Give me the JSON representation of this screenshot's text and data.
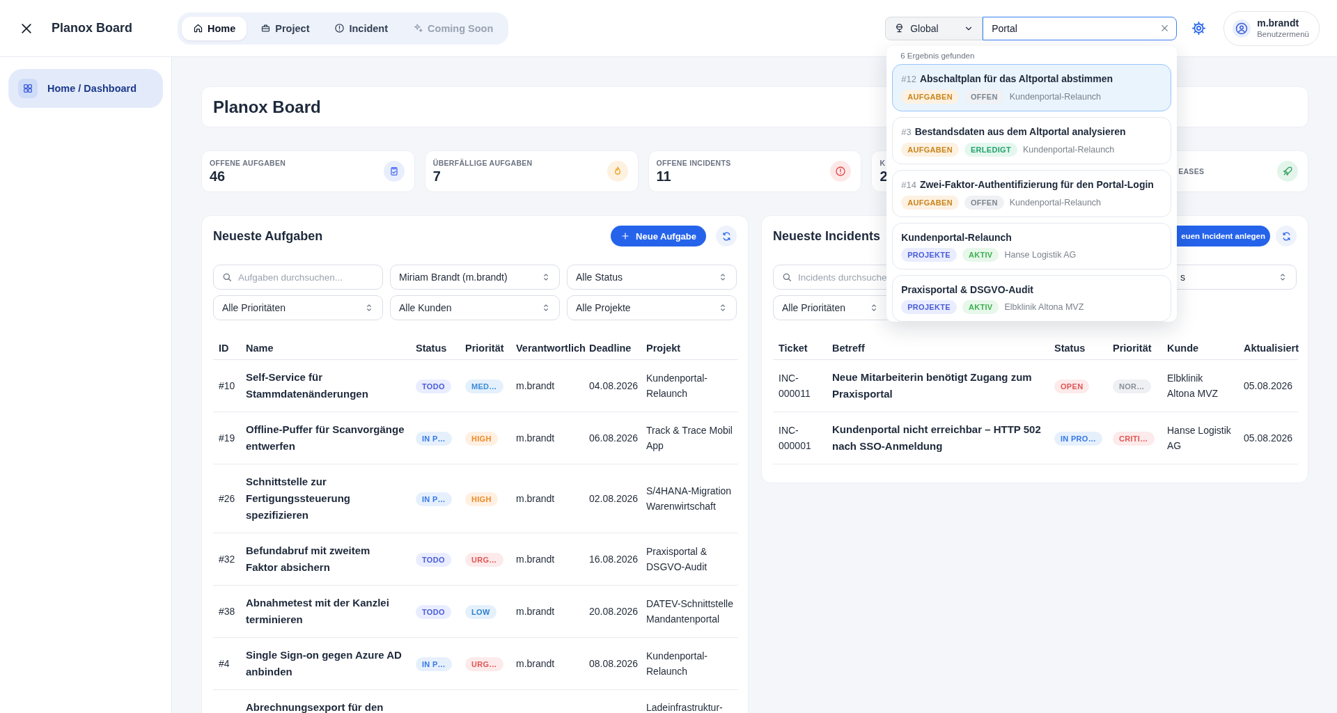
{
  "app": {
    "title": "Planox Board"
  },
  "nav": {
    "tabs": [
      {
        "label": "Home",
        "selected": true,
        "disabled": false
      },
      {
        "label": "Project",
        "selected": false,
        "disabled": false
      },
      {
        "label": "Incident",
        "selected": false,
        "disabled": false
      },
      {
        "label": "Coming Soon",
        "selected": false,
        "disabled": true
      }
    ]
  },
  "search": {
    "scope": "Global",
    "query": "Portal",
    "count": "6 Ergebnis gefunden",
    "results": [
      {
        "ref": "#12",
        "title": "Abschaltplan für das Altportal abstimmen",
        "type": {
          "label": "AUFGABEN",
          "kind": "task"
        },
        "state": {
          "label": "OFFEN",
          "kind": "open"
        },
        "context": "Kundenportal-Relaunch",
        "selected": true
      },
      {
        "ref": "#3",
        "title": "Bestandsdaten aus dem Altportal analysieren",
        "type": {
          "label": "AUFGABEN",
          "kind": "task"
        },
        "state": {
          "label": "ERLEDIGT",
          "kind": "done"
        },
        "context": "Kundenportal-Relaunch",
        "selected": false
      },
      {
        "ref": "#14",
        "title": "Zwei-Faktor-Authentifizierung für den Portal-Login",
        "type": {
          "label": "AUFGABEN",
          "kind": "task"
        },
        "state": {
          "label": "OFFEN",
          "kind": "open"
        },
        "context": "Kundenportal-Relaunch",
        "selected": false
      },
      {
        "title": "Kundenportal-Relaunch",
        "type": {
          "label": "PROJEKTE",
          "kind": "project"
        },
        "state": {
          "label": "AKTIV",
          "kind": "active"
        },
        "context": "Hanse Logistik AG",
        "selected": false
      },
      {
        "title": "Praxisportal & DSGVO-Audit",
        "type": {
          "label": "PROJEKTE",
          "kind": "project"
        },
        "state": {
          "label": "AKTIV",
          "kind": "active"
        },
        "context": "Elbklinik Altona MVZ",
        "selected": false
      }
    ]
  },
  "user": {
    "name": "m.brandt",
    "role": "Benutzermenü"
  },
  "sidebar": {
    "items": [
      {
        "label": "Home / Dashboard",
        "selected": true
      }
    ]
  },
  "page": {
    "title": "Planox Board"
  },
  "kpis": [
    {
      "label": "OFFENE AUFGABEN",
      "value": "46"
    },
    {
      "label": "ÜBERFÄLLIGE AUFGABEN",
      "value": "7"
    },
    {
      "label": "OFFENE INCIDENTS",
      "value": "11"
    },
    {
      "label": "K",
      "value": "2"
    },
    {
      "label": "EASES"
    }
  ],
  "tasks": {
    "title": "Neueste Aufgaben",
    "new_button": "Neue Aufgabe",
    "search_placeholder": "Aufgaben durchsuchen...",
    "filters": [
      "Miriam Brandt (m.brandt)",
      "Alle Status",
      "Alle Prioritäten",
      "Alle Kunden",
      "Alle Projekte"
    ],
    "columns": [
      "ID",
      "Name",
      "Status",
      "Priorität",
      "Verantwortlich",
      "Deadline",
      "Projekt"
    ],
    "rows": [
      {
        "id": "#10",
        "name": "Self-Service für Stammdatenänderungen",
        "status": {
          "label": "TODO",
          "kind": "todo"
        },
        "priority": {
          "label": "MED…",
          "kind": "medium"
        },
        "owner": "m.brandt",
        "deadline": "04.08.2026",
        "project": "Kundenportal-Relaunch"
      },
      {
        "id": "#19",
        "name": "Offline-Puffer für Scanvorgänge entwerfen",
        "status": {
          "label": "IN P…",
          "kind": "in_progress"
        },
        "priority": {
          "label": "HIGH",
          "kind": "high"
        },
        "owner": "m.brandt",
        "deadline": "06.08.2026",
        "project": "Track & Trace Mobil App"
      },
      {
        "id": "#26",
        "name": "Schnittstelle zur Fertigungssteuerung spezifizieren",
        "status": {
          "label": "IN P…",
          "kind": "in_progress"
        },
        "priority": {
          "label": "HIGH",
          "kind": "high"
        },
        "owner": "m.brandt",
        "deadline": "02.08.2026",
        "project": "S/4HANA-Migration Warenwirtschaft"
      },
      {
        "id": "#32",
        "name": "Befundabruf mit zweitem Faktor absichern",
        "status": {
          "label": "TODO",
          "kind": "todo"
        },
        "priority": {
          "label": "URG…",
          "kind": "urgent"
        },
        "owner": "m.brandt",
        "deadline": "16.08.2026",
        "project": "Praxisportal & DSGVO-Audit"
      },
      {
        "id": "#38",
        "name": "Abnahmetest mit der Kanzlei terminieren",
        "status": {
          "label": "TODO",
          "kind": "todo"
        },
        "priority": {
          "label": "LOW",
          "kind": "low"
        },
        "owner": "m.brandt",
        "deadline": "20.08.2026",
        "project": "DATEV-Schnittstelle Mandantenportal"
      },
      {
        "id": "#4",
        "name": "Single Sign-on gegen Azure AD anbinden",
        "status": {
          "label": "IN P…",
          "kind": "in_progress"
        },
        "priority": {
          "label": "URG…",
          "kind": "urgent"
        },
        "owner": "m.brandt",
        "deadline": "08.08.2026",
        "project": "Kundenportal-Relaunch"
      },
      {
        "name": "Abrechnungsexport für den",
        "project": "Ladeinfrastruktur-"
      }
    ]
  },
  "incidents": {
    "title": "Neueste Incidents",
    "new_button": "euen Incident anlegen",
    "search_placeholder": "Incidents durchsuche",
    "status_filter": "s",
    "priority_filter": "Alle Prioritäten",
    "columns": [
      "Ticket",
      "Betreff",
      "Status",
      "Priorität",
      "Kunde",
      "Aktualisiert"
    ],
    "rows": [
      {
        "ticket": "INC-000011",
        "subject": "Neue Mitarbeiterin benötigt Zugang zum Praxisportal",
        "status": {
          "label": "OPEN",
          "kind": "open"
        },
        "priority": {
          "label": "NOR…",
          "kind": "normal"
        },
        "customer": "Elbklinik Altona MVZ",
        "updated": "05.08.2026"
      },
      {
        "ticket": "INC-000001",
        "subject": "Kundenportal nicht erreichbar – HTTP 502 nach SSO-Anmeldung",
        "status": {
          "label": "IN PRO…",
          "kind": "in_progress"
        },
        "priority": {
          "label": "CRITI…",
          "kind": "critical"
        },
        "customer": "Hanse Logistik AG",
        "updated": "05.08.2026"
      }
    ]
  }
}
